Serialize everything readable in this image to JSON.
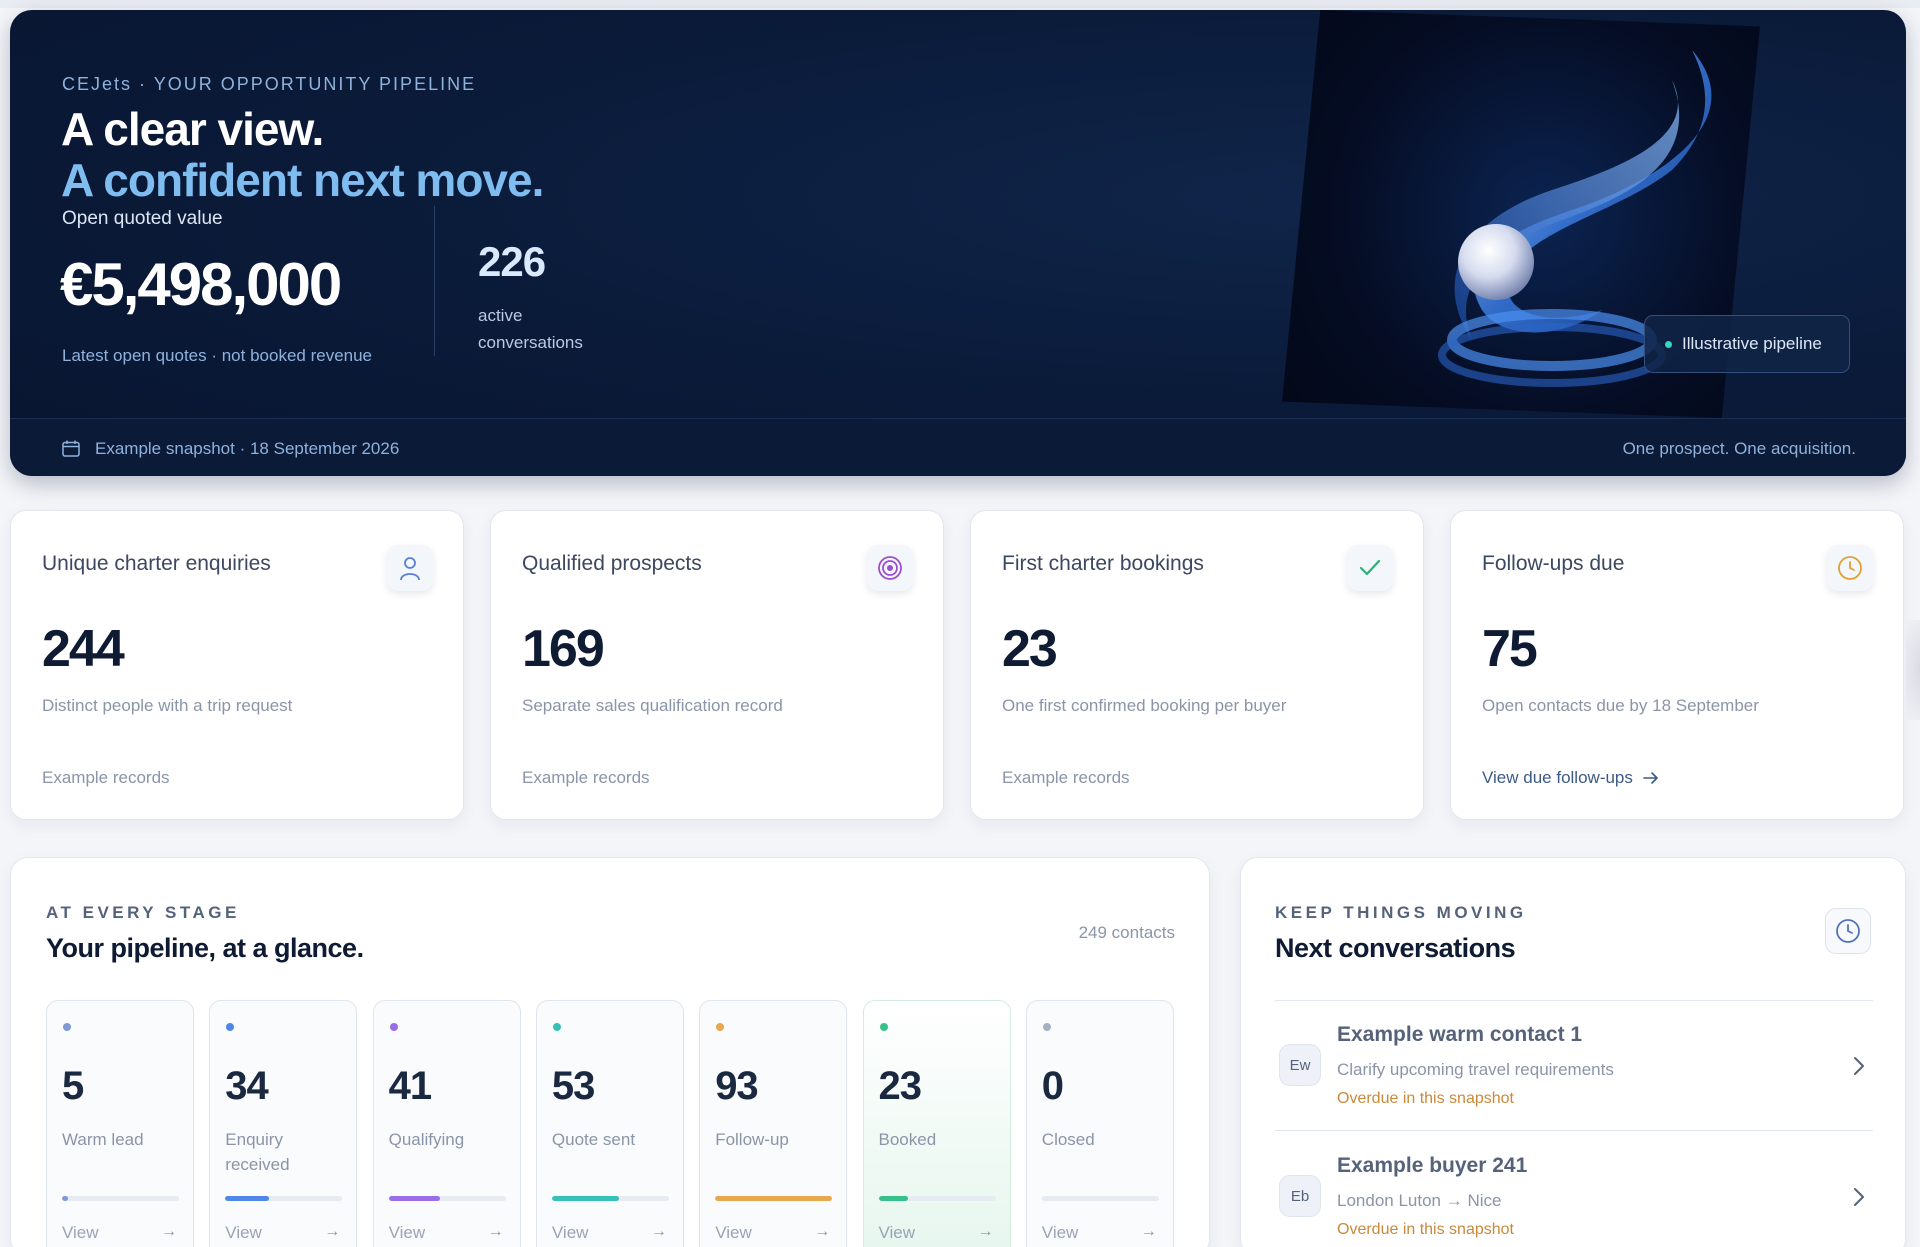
{
  "hero": {
    "eyebrow": "CEJets · YOUR OPPORTUNITY PIPELINE",
    "title_line1": "A clear view.",
    "title_line2": "A confident next move.",
    "open_label": "Open quoted value",
    "open_value": "€5,498,000",
    "open_note": "Latest open quotes · not booked revenue",
    "active_count": "226",
    "active_label": "active conversations",
    "pill_label": "Illustrative pipeline",
    "snapshot": "Example snapshot · 18 September 2026",
    "tagline": "One prospect. One acquisition."
  },
  "stats": [
    {
      "title": "Unique charter enquiries",
      "value": "244",
      "desc": "Distinct people with a trip request",
      "foot": "Example records",
      "icon": "person-icon",
      "icon_color": "#5b7fd8"
    },
    {
      "title": "Qualified prospects",
      "value": "169",
      "desc": "Separate sales qualification record",
      "foot": "Example records",
      "icon": "target-icon",
      "icon_color": "#9b4fd0"
    },
    {
      "title": "First charter bookings",
      "value": "23",
      "desc": "One first confirmed booking per buyer",
      "foot": "Example records",
      "icon": "check-icon",
      "icon_color": "#2fae7a"
    },
    {
      "title": "Follow-ups due",
      "value": "75",
      "desc": "Open contacts due by 18 September",
      "foot": "View due follow-ups",
      "icon": "clock-icon",
      "icon_color": "#e0a030"
    }
  ],
  "pipeline": {
    "eyebrow": "AT EVERY STAGE",
    "title": "Your pipeline, at a glance.",
    "contacts": "249 contacts",
    "view_label": "View",
    "stages": [
      {
        "value": "5",
        "label": "Warm lead",
        "color": "#7f9ad3",
        "progress": 0.05
      },
      {
        "value": "34",
        "label": "Enquiry received",
        "color": "#4f86e8",
        "progress": 0.37
      },
      {
        "value": "41",
        "label": "Qualifying",
        "color": "#9a6ee6",
        "progress": 0.44
      },
      {
        "value": "53",
        "label": "Quote sent",
        "color": "#36c0b8",
        "progress": 0.57
      },
      {
        "value": "93",
        "label": "Follow-up",
        "color": "#e8a84e",
        "progress": 1.0
      },
      {
        "value": "23",
        "label": "Booked",
        "color": "#38c08a",
        "progress": 0.25
      },
      {
        "value": "0",
        "label": "Closed",
        "color": "#a7b0c0",
        "progress": 0.0
      }
    ]
  },
  "next": {
    "eyebrow": "KEEP THINGS MOVING",
    "title": "Next conversations",
    "items": [
      {
        "initials": "Ew",
        "name": "Example warm contact 1",
        "sub": "Clarify upcoming travel requirements",
        "status": "Overdue in this snapshot"
      },
      {
        "initials": "Eb",
        "name": "Example buyer 241",
        "sub": "London Luton → Nice",
        "status": "Overdue in this snapshot"
      }
    ]
  }
}
